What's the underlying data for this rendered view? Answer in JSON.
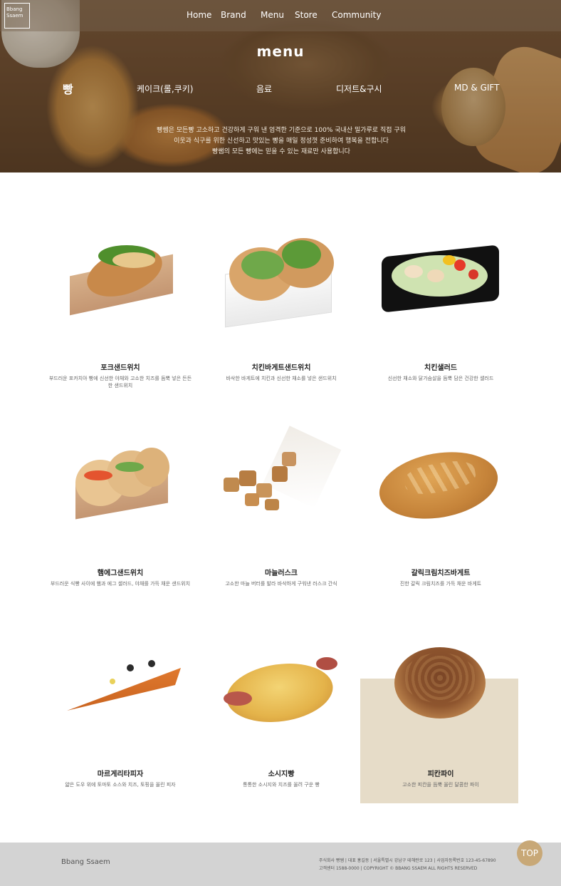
{
  "header": {
    "logo_line1": "Bbang",
    "logo_line2": "Ssaem",
    "nav": [
      "Home",
      "Brand",
      "Menu",
      "Store",
      "Community"
    ]
  },
  "page_title": "menu",
  "categories": [
    "빵",
    "케이크(롤,쿠키)",
    "음료",
    "디저트&구시",
    "MD & GIFT"
  ],
  "active_category": "빵",
  "intro_lines": [
    "빵쌤은 모든빵 고소하고 건강하게 구워 낸 엄격한 기준으로 100% 국내산 밀가루로 직접 구워",
    "이웃과 식구를 위한 신선하고 맛있는 빵을 매일 정성껏 준비하여 행복을 전합니다",
    "빵쌤의 모든 빵에는 믿을 수 있는 재료만 사용합니다"
  ],
  "products": [
    {
      "name": "포크샌드위치",
      "desc": "부드러운 포카치아 빵에 신선한 야채와 고소한 치즈를 듬뿍 넣은 든든한 샌드위치"
    },
    {
      "name": "치킨바게트샌드위치",
      "desc": "바삭한 바게트에 치킨과 신선한 채소를 넣은 샌드위치"
    },
    {
      "name": "치킨샐러드",
      "desc": "신선한 채소와 닭가슴살을 듬뿍 담은 건강한 샐러드"
    },
    {
      "name": "햄에그샌드위치",
      "desc": "부드러운 식빵 사이에 햄과 에그 샐러드, 야채를 가득 채운 샌드위치"
    },
    {
      "name": "마늘러스크",
      "desc": "고소한 마늘 버터를 발라 바삭하게 구워낸 러스크 간식"
    },
    {
      "name": "갈릭크림치즈바게트",
      "desc": "진한 갈릭 크림치즈를 가득 채운 바게트"
    },
    {
      "name": "마르게리타피자",
      "desc": "얇은 도우 위에 토마토 소스와 치즈, 토핑을 올린 피자"
    },
    {
      "name": "소시지빵",
      "desc": "통통한 소시지와 치즈를 올려 구운 빵"
    },
    {
      "name": "피칸파이",
      "desc": "고소한 피칸을 듬뿍 올린 달콤한 파이"
    }
  ],
  "footer": {
    "logo": "Bbang Ssaem",
    "info_lines": [
      "주식회사 빵쌤 | 대표 홍길동 | 서울특별시 강남구 테헤란로 123 | 사업자등록번호 123-45-67890",
      "고객센터 1588-0000 | COPYRIGHT © BBANG SSAEM ALL RIGHTS RESERVED"
    ]
  },
  "top_button_label": "TOP",
  "colors": {
    "hover_bg": "#e6dcc8",
    "footer_bg": "#d3d3d3",
    "top_button": "#c8a877"
  }
}
